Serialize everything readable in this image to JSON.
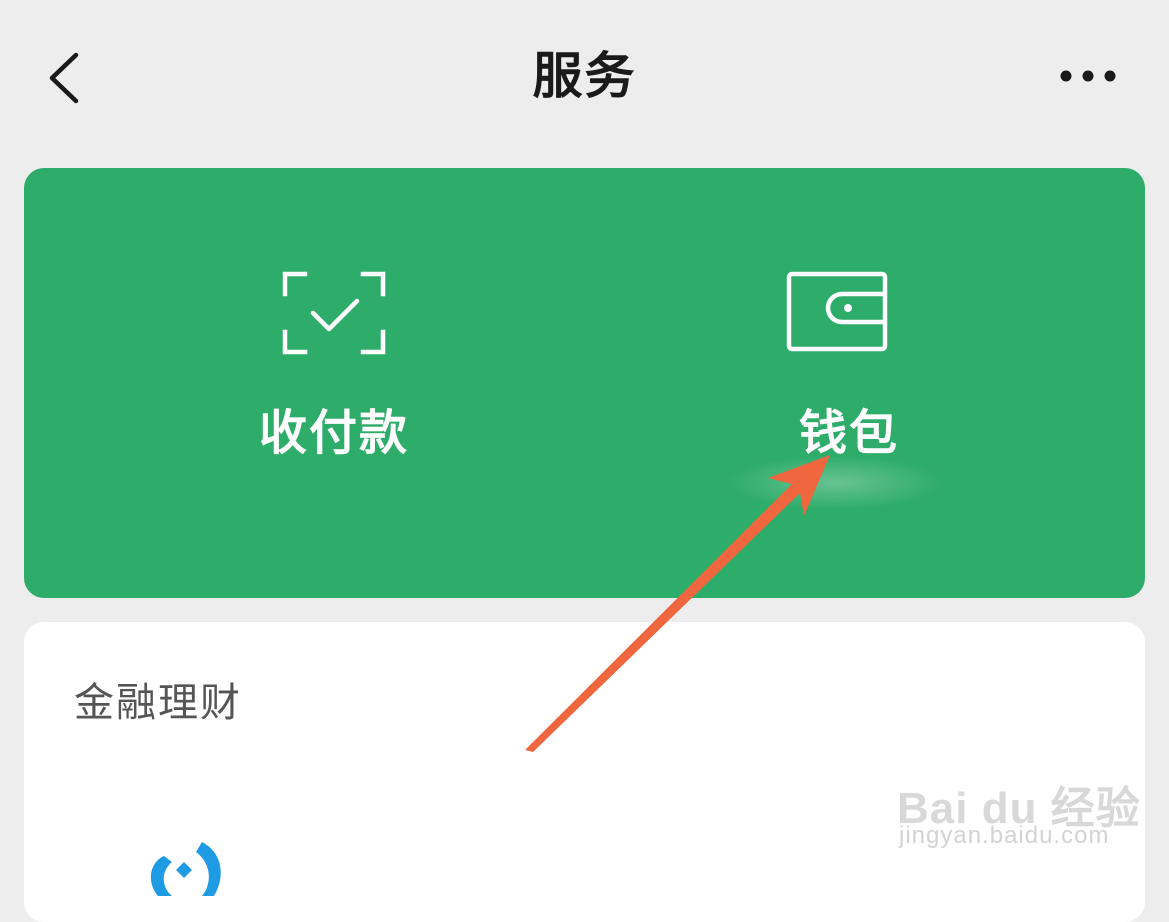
{
  "header": {
    "title": "服务"
  },
  "hero": {
    "items": [
      {
        "label": "收付款",
        "icon": "scan-check-icon"
      },
      {
        "label": "钱包",
        "icon": "wallet-icon"
      }
    ],
    "color": "#2eac69"
  },
  "finance": {
    "section_title": "金融理财"
  },
  "watermark": {
    "line1": "Bai du 经验",
    "line2": "jingyan.baidu.com"
  }
}
